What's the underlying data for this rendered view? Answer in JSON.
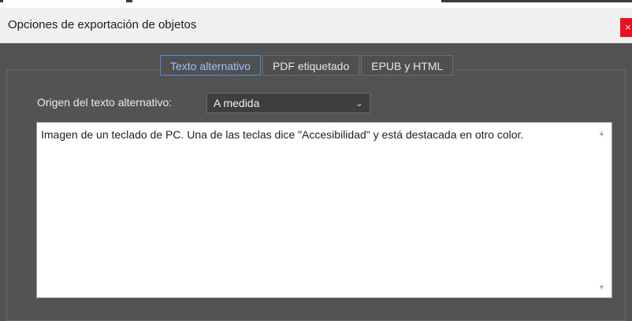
{
  "window": {
    "title": "Opciones de exportación de objetos",
    "close_glyph": "×"
  },
  "tabs": [
    {
      "label": "Texto alternativo",
      "active": true
    },
    {
      "label": "PDF etiquetado",
      "active": false
    },
    {
      "label": "EPUB y HTML",
      "active": false
    }
  ],
  "alt_text": {
    "source_label": "Origen del texto alternativo:",
    "source_value": "A medida",
    "content": "Imagen de un teclado de PC. Una de las teclas dice \"Accesibilidad\" y está destacada en otro color."
  },
  "icons": {
    "dropdown": "chevron-down-icon",
    "scroll_up": "scroll-up-arrow-icon",
    "scroll_down": "scroll-down-arrow-icon",
    "close": "close-icon"
  },
  "colors": {
    "dialog_bg": "#535353",
    "titlebar_bg": "#f0f0f0",
    "active_tab_border": "#4a90e2",
    "active_tab_text": "#9fc4ff",
    "close_bg": "#e81123"
  }
}
